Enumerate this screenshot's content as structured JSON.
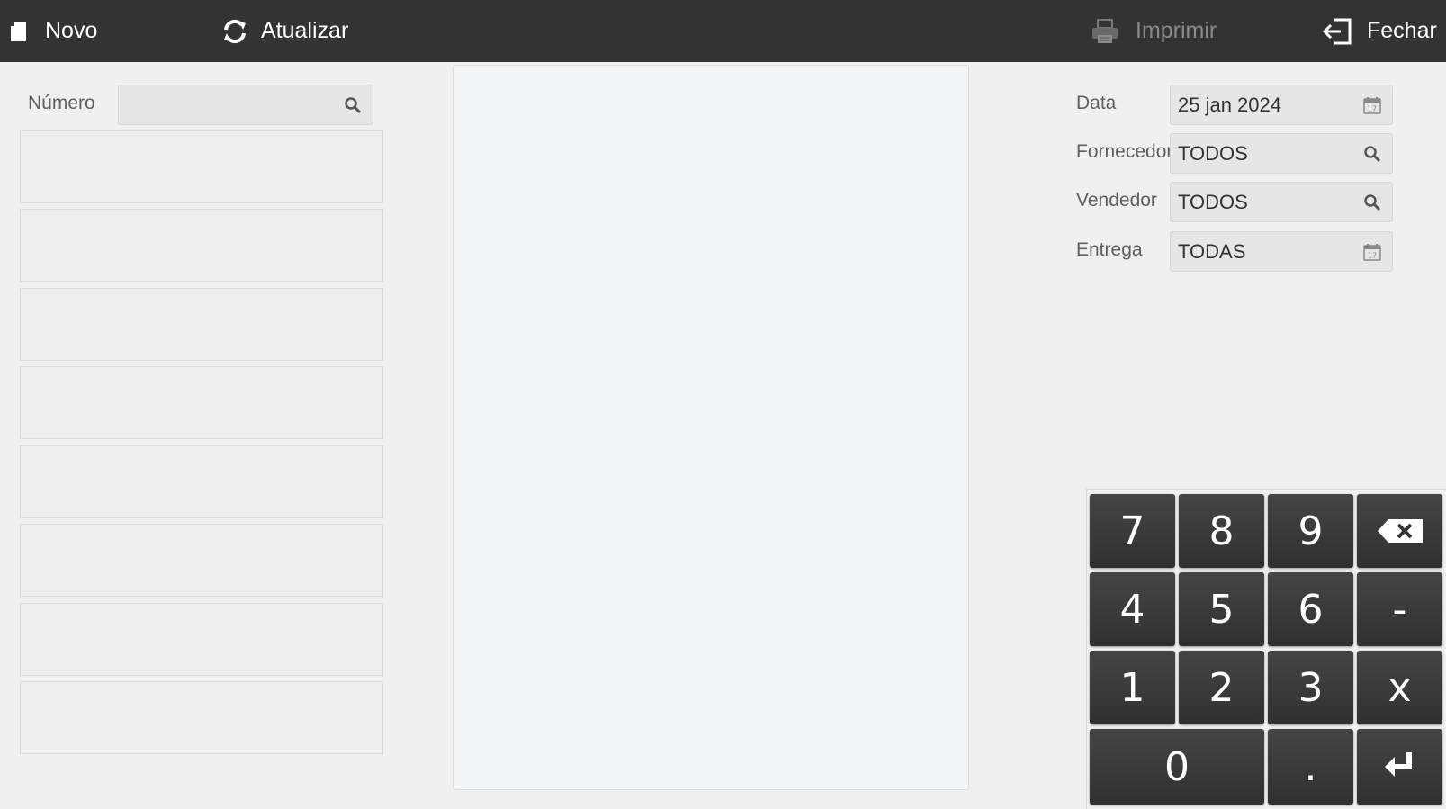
{
  "toolbar": {
    "novo": {
      "label": "Novo",
      "icon": "new-document-icon"
    },
    "atualizar": {
      "label": "Atualizar",
      "icon": "refresh-icon"
    },
    "imprimir": {
      "label": "Imprimir",
      "icon": "printer-icon",
      "enabled": false
    },
    "fechar": {
      "label": "Fechar",
      "icon": "exit-icon"
    }
  },
  "search": {
    "numero_label": "Número",
    "numero_value": "",
    "icon": "search-icon"
  },
  "filters": {
    "data_label": "Data",
    "data_value": "25 jan 2024",
    "fornecedor_label": "Fornecedor",
    "fornecedor_value": "TODOS",
    "vendedor_label": "Vendedor",
    "vendedor_value": "TODOS",
    "entrega_label": "Entrega",
    "entrega_value": "TODAS"
  },
  "list": {
    "items": [
      "",
      "",
      "",
      "",
      "",
      "",
      "",
      ""
    ]
  },
  "keypad": {
    "k7": "7",
    "k8": "8",
    "k9": "9",
    "k4": "4",
    "k5": "5",
    "k6": "6",
    "minus": "-",
    "k1": "1",
    "k2": "2",
    "k3": "3",
    "x": "x",
    "k0": "0",
    "dot": ".",
    "backspace_icon": "backspace-icon",
    "enter_icon": "enter-icon"
  },
  "colors": {
    "toolbar_bg": "#333333",
    "page_bg": "#f0f0f0",
    "key_bg": "#3a3a3a",
    "disabled_text": "#8a8a8a"
  }
}
